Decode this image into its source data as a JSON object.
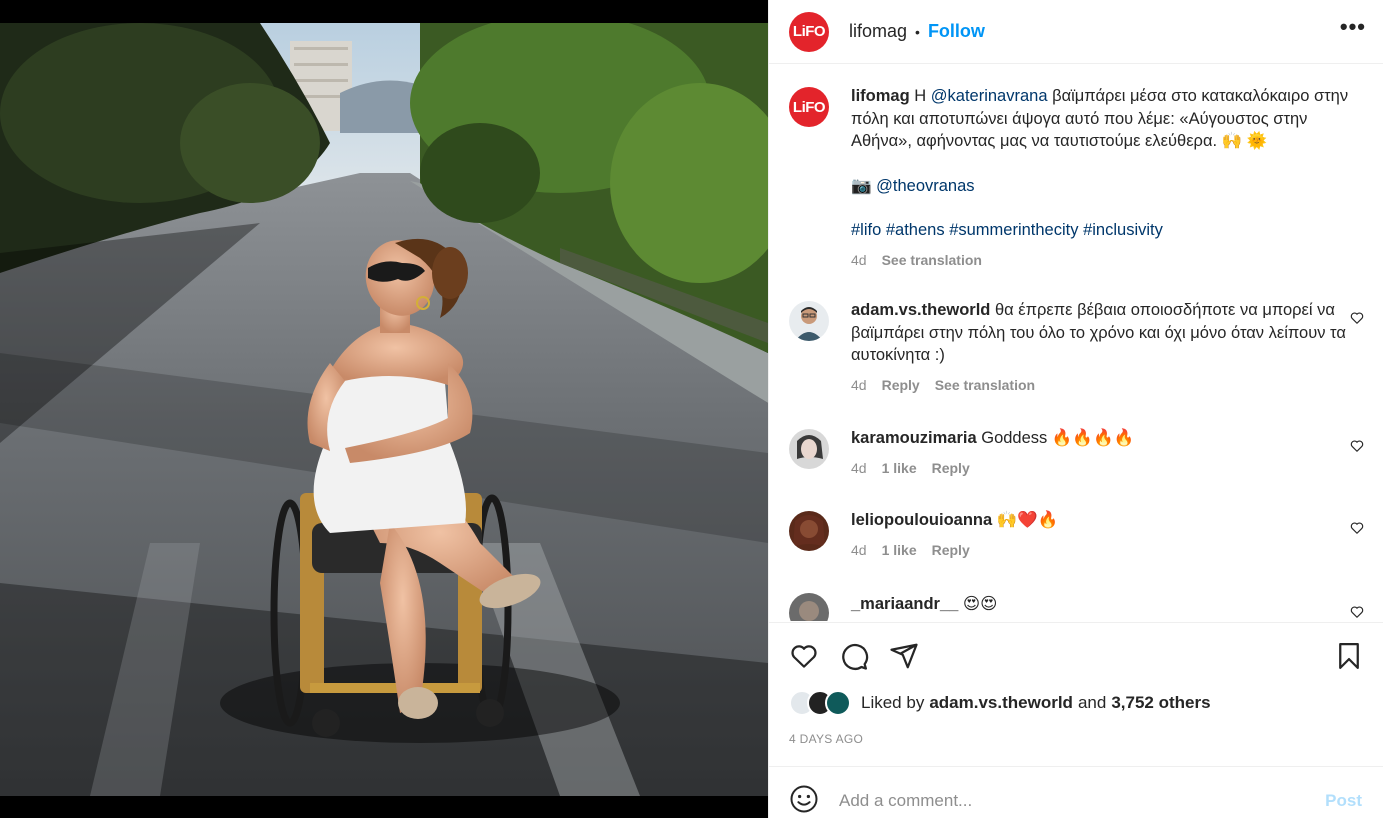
{
  "header": {
    "avatar_text": "LiFO",
    "username": "lifomag",
    "separator": "•",
    "follow_label": "Follow",
    "more_label": "•••"
  },
  "caption": {
    "username": "lifomag",
    "text_before": "Η",
    "mention": "@katerinavrana",
    "text_after": "βαϊμπάρει μέσα στο κατακαλόκαιρο στην πόλη και αποτυπώνει άψογα αυτό που λέμε: «Αύγουστος στην Αθήνα», αφήνοντας μας να ταυτιστούμε ελεύθερα. 🙌 🌞",
    "photo_credit_icon": "📷",
    "photo_credit": "@theovranas",
    "hashtags": [
      "#lifo",
      "#athens",
      "#summerinthecity",
      "#inclusivity"
    ],
    "age": "4d",
    "see_translation": "See translation"
  },
  "comments": [
    {
      "username": "adam.vs.theworld",
      "text": "θα έπρεπε βέβαια οποιοσδήποτε να μπορεί να βαϊμπάρει στην πόλη του όλο το χρόνο και όχι μόνο όταν λείπουν τα αυτοκίνητα :)",
      "age": "4d",
      "reply": "Reply",
      "see_translation": "See translation"
    },
    {
      "username": "karamouzimaria",
      "text": "Goddess 🔥🔥🔥🔥",
      "age": "4d",
      "likes": "1 like",
      "reply": "Reply"
    },
    {
      "username": "leliopoulouioanna",
      "text": "🙌❤️🔥",
      "age": "4d",
      "likes": "1 like",
      "reply": "Reply"
    },
    {
      "username": "_mariaandr__",
      "text": "😍😍"
    }
  ],
  "likes": {
    "prefix": "Liked by",
    "user": "adam.vs.theworld",
    "joiner": "and",
    "others": "3,752 others"
  },
  "post_time": "4 DAYS AGO",
  "add_comment": {
    "placeholder": "Add a comment...",
    "post_label": "Post"
  },
  "icons": {
    "like": "heart-icon",
    "comment": "comment-icon",
    "share": "share-icon",
    "save": "bookmark-icon",
    "emoji": "smile-icon"
  },
  "colors": {
    "brand_red": "#e3242b",
    "follow_blue": "#0095f6",
    "link_blue": "#00376b",
    "post_disabled": "#b2dffc"
  }
}
